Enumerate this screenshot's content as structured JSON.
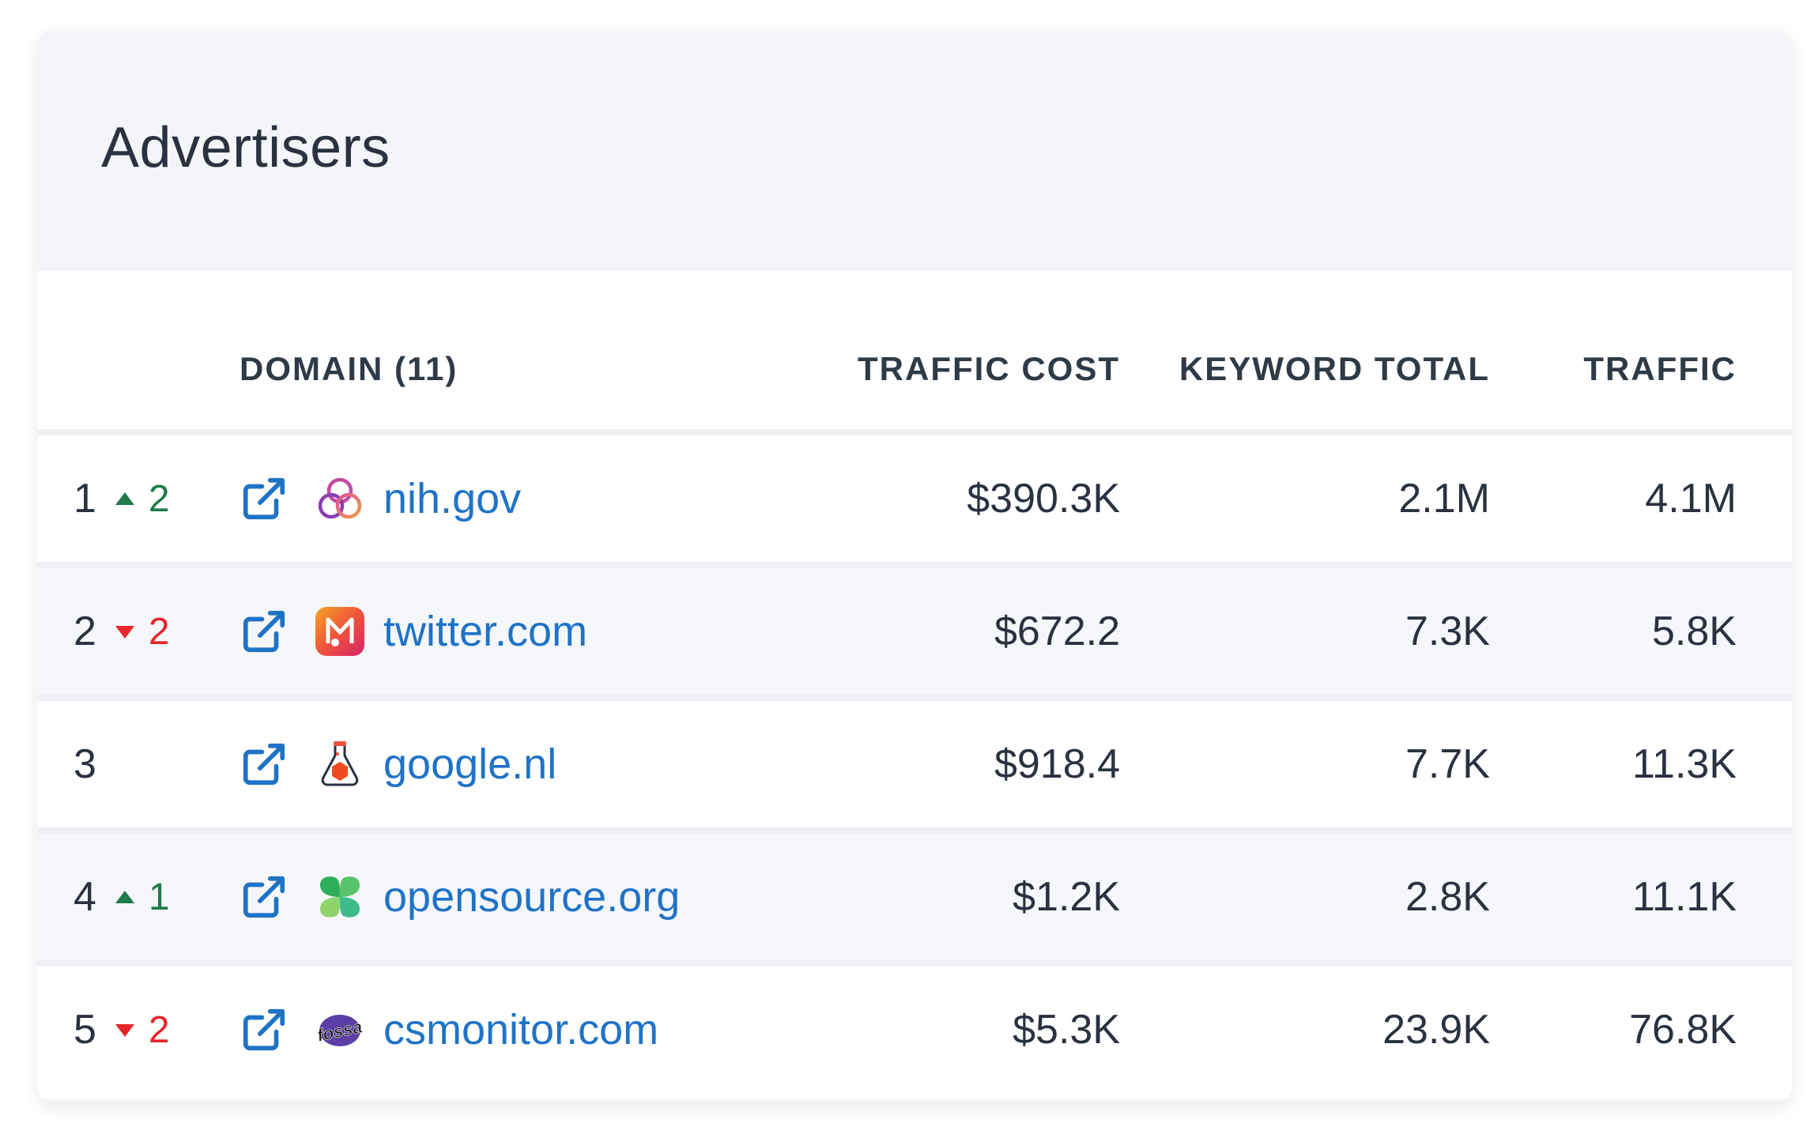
{
  "card": {
    "title": "Advertisers"
  },
  "columns": {
    "domain": "DOMAIN (11)",
    "traffic_cost": "TRAFFIC COST",
    "keyword_total": "KEYWORD TOTAL",
    "traffic": "TRAFFIC"
  },
  "rows": [
    {
      "rank": "1",
      "direction": "up",
      "delta": "2",
      "domain": "nih.gov",
      "favicon": "triple-ring-icon",
      "traffic_cost": "$390.3K",
      "keyword_total": "2.1M",
      "traffic": "4.1M"
    },
    {
      "rank": "2",
      "direction": "down",
      "delta": "2",
      "domain": "twitter.com",
      "favicon": "music-m-app-icon",
      "traffic_cost": "$672.2",
      "keyword_total": "7.3K",
      "traffic": "5.8K"
    },
    {
      "rank": "3",
      "direction": "none",
      "delta": "",
      "domain": "google.nl",
      "favicon": "flask-icon",
      "traffic_cost": "$918.4",
      "keyword_total": "7.7K",
      "traffic": "11.3K"
    },
    {
      "rank": "4",
      "direction": "up",
      "delta": "1",
      "domain": "opensource.org",
      "favicon": "green-clover-icon",
      "traffic_cost": "$1.2K",
      "keyword_total": "2.8K",
      "traffic": "11.1K"
    },
    {
      "rank": "5",
      "direction": "down",
      "delta": "2",
      "domain": "csmonitor.com",
      "favicon": "fossa-logo",
      "favicon_text": "fossa",
      "traffic_cost": "$5.3K",
      "keyword_total": "23.9K",
      "traffic": "76.8K"
    }
  ],
  "colors": {
    "link": "#1f73c7",
    "up": "#1f7a4c",
    "down": "#e5262b",
    "header_text": "#2f3a47"
  }
}
